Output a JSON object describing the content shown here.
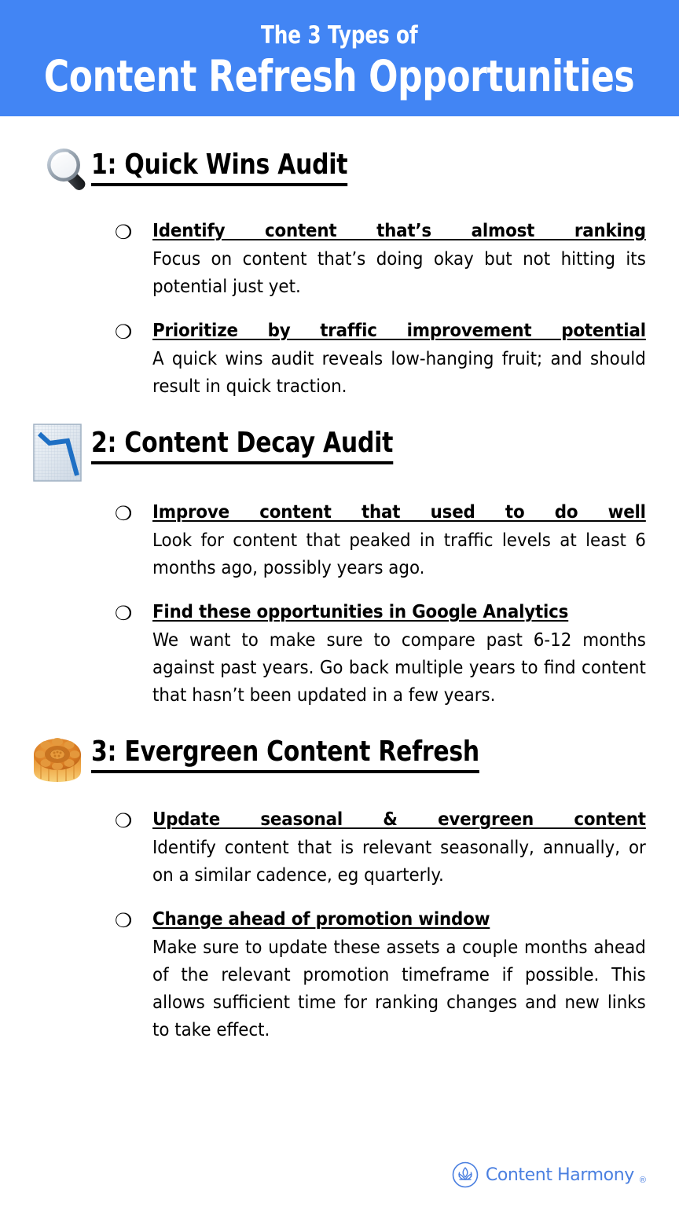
{
  "header": {
    "eyebrow": "The 3 Types of",
    "title": "Content Refresh Opportunities",
    "background_color": "#4285F4",
    "text_color": "#FFFFFF"
  },
  "sections": [
    {
      "icon": "magnifying-glass-icon",
      "title": "1: Quick Wins Audit",
      "bullets": [
        {
          "marker": "ballot-box-icon",
          "title": "Identify content that’s almost ranking",
          "body": "Focus on content that’s doing okay but not hitting its potential just yet."
        },
        {
          "marker": "ballot-box-icon",
          "title": "Prioritize by traffic improvement potential",
          "body": "A quick wins audit reveals low-hanging fruit; and should result in quick traction."
        }
      ]
    },
    {
      "icon": "chart-decreasing-icon",
      "title": "2: Content Decay Audit",
      "bullets": [
        {
          "marker": "ballot-box-icon",
          "title": "Improve content that used to do well",
          "body": "Look for content that peaked in traffic levels at least 6 months ago, possibly years ago."
        },
        {
          "marker": "ballot-box-icon",
          "title": "Find these opportunities in Google Analytics",
          "body": "We want to make sure to compare past 6-12 months against past years. Go back multiple years to find content that hasn’t been updated in a few years."
        }
      ]
    },
    {
      "icon": "moon-cake-icon",
      "title": "3: Evergreen Content Refresh",
      "bullets": [
        {
          "marker": "ballot-box-icon",
          "title": "Update seasonal & evergreen content",
          "body": "Identify content that is relevant seasonally, annually, or on a similar cadence, eg quarterly."
        },
        {
          "marker": "ballot-box-icon",
          "title": "Change ahead of promotion window",
          "body": "Make sure to update these assets a couple months ahead of the relevant promotion timeframe if possible. This allows sufficient time for ranking changes and new links to take effect."
        }
      ]
    }
  ],
  "footer": {
    "brand": "Content Harmony",
    "trademark": "®",
    "logo_color": "#4A7FE0",
    "logo_mark": "lotus-circle-icon"
  }
}
